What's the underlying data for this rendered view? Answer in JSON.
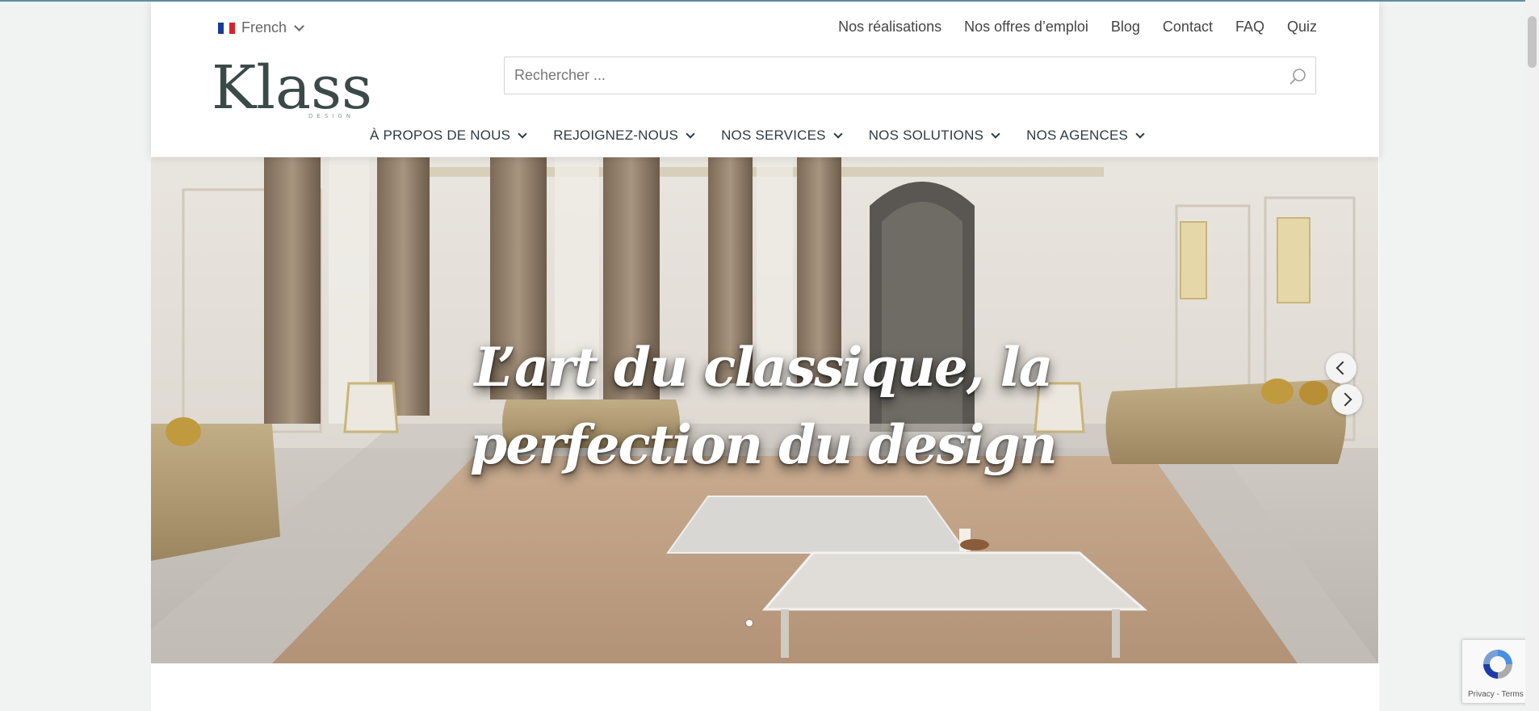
{
  "language": {
    "label": "French"
  },
  "util_nav": [
    "Nos réalisations",
    "Nos offres d’emploi",
    "Blog",
    "Contact",
    "FAQ",
    "Quiz"
  ],
  "logo": {
    "text": "Klass",
    "sub": "DESIGN"
  },
  "search": {
    "placeholder": "Rechercher ..."
  },
  "main_nav": [
    "À PROPOS DE NOUS",
    "REJOIGNEZ-NOUS",
    "NOS SERVICES",
    "NOS SOLUTIONS",
    "NOS AGENCES"
  ],
  "hero": {
    "title": "L’art du classique, la perfection du design"
  },
  "recaptcha": {
    "privacy": "Privacy",
    "separator": " - ",
    "terms": "Terms"
  },
  "colors": {
    "accent": "#5f8fa3",
    "nav_text": "#2f3a44",
    "background": "#f1f2f2"
  }
}
